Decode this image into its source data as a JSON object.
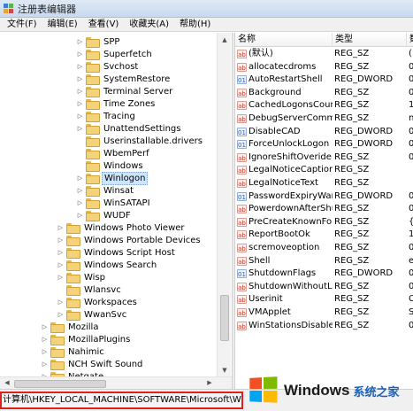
{
  "window": {
    "title": "注册表编辑器"
  },
  "menu": [
    "文件(F)",
    "编辑(E)",
    "查看(V)",
    "收藏夹(A)",
    "帮助(H)"
  ],
  "tree": {
    "items": [
      {
        "label": "SPP",
        "level": 2,
        "expandable": true
      },
      {
        "label": "Superfetch",
        "level": 2,
        "expandable": true
      },
      {
        "label": "Svchost",
        "level": 2,
        "expandable": true
      },
      {
        "label": "SystemRestore",
        "level": 2,
        "expandable": true
      },
      {
        "label": "Terminal Server",
        "level": 2,
        "expandable": true
      },
      {
        "label": "Time Zones",
        "level": 2,
        "expandable": true
      },
      {
        "label": "Tracing",
        "level": 2,
        "expandable": true
      },
      {
        "label": "UnattendSettings",
        "level": 2,
        "expandable": true
      },
      {
        "label": "Userinstallable.drivers",
        "level": 2,
        "expandable": false
      },
      {
        "label": "WbemPerf",
        "level": 2,
        "expandable": false
      },
      {
        "label": "Windows",
        "level": 2,
        "expandable": false
      },
      {
        "label": "Winlogon",
        "level": 2,
        "expandable": true,
        "selected": true
      },
      {
        "label": "Winsat",
        "level": 2,
        "expandable": true
      },
      {
        "label": "WinSATAPI",
        "level": 2,
        "expandable": true
      },
      {
        "label": "WUDF",
        "level": 2,
        "expandable": true
      },
      {
        "label": "Windows Photo Viewer",
        "level": 1,
        "expandable": true
      },
      {
        "label": "Windows Portable Devices",
        "level": 1,
        "expandable": true
      },
      {
        "label": "Windows Script Host",
        "level": 1,
        "expandable": true
      },
      {
        "label": "Windows Search",
        "level": 1,
        "expandable": true
      },
      {
        "label": "Wisp",
        "level": 1,
        "expandable": true
      },
      {
        "label": "Wlansvc",
        "level": 1,
        "expandable": false
      },
      {
        "label": "Workspaces",
        "level": 1,
        "expandable": true
      },
      {
        "label": "WwanSvc",
        "level": 1,
        "expandable": true
      },
      {
        "label": "Mozilla",
        "level": 0,
        "expandable": true
      },
      {
        "label": "MozillaPlugins",
        "level": 0,
        "expandable": true
      },
      {
        "label": "Nahimic",
        "level": 0,
        "expandable": true
      },
      {
        "label": "NCH Swift Sound",
        "level": 0,
        "expandable": true
      },
      {
        "label": "Netgate",
        "level": 0,
        "expandable": true
      }
    ]
  },
  "list": {
    "columns": {
      "name": "名称",
      "type": "类型",
      "data": "数"
    },
    "rows": [
      {
        "name": "(默认)",
        "type": "REG_SZ",
        "data": "(",
        "kind": "sz"
      },
      {
        "name": "allocatecdroms",
        "type": "REG_SZ",
        "data": "0",
        "kind": "sz"
      },
      {
        "name": "AutoRestartShell",
        "type": "REG_DWORD",
        "data": "0",
        "kind": "dw"
      },
      {
        "name": "Background",
        "type": "REG_SZ",
        "data": "0",
        "kind": "sz"
      },
      {
        "name": "CachedLogonsCount",
        "type": "REG_SZ",
        "data": "1",
        "kind": "sz"
      },
      {
        "name": "DebugServerCommand",
        "type": "REG_SZ",
        "data": "n",
        "kind": "sz"
      },
      {
        "name": "DisableCAD",
        "type": "REG_DWORD",
        "data": "0",
        "kind": "dw"
      },
      {
        "name": "ForceUnlockLogon",
        "type": "REG_DWORD",
        "data": "0",
        "kind": "dw"
      },
      {
        "name": "IgnoreShiftOveride",
        "type": "REG_SZ",
        "data": "0",
        "kind": "sz"
      },
      {
        "name": "LegalNoticeCaption",
        "type": "REG_SZ",
        "data": "",
        "kind": "sz"
      },
      {
        "name": "LegalNoticeText",
        "type": "REG_SZ",
        "data": "",
        "kind": "sz"
      },
      {
        "name": "PasswordExpiryWarni...",
        "type": "REG_DWORD",
        "data": "0",
        "kind": "dw"
      },
      {
        "name": "PowerdownAfterShut...",
        "type": "REG_SZ",
        "data": "0",
        "kind": "sz"
      },
      {
        "name": "PreCreateKnownFold...",
        "type": "REG_SZ",
        "data": "{",
        "kind": "sz"
      },
      {
        "name": "ReportBootOk",
        "type": "REG_SZ",
        "data": "1",
        "kind": "sz"
      },
      {
        "name": "scremoveoption",
        "type": "REG_SZ",
        "data": "0",
        "kind": "sz"
      },
      {
        "name": "Shell",
        "type": "REG_SZ",
        "data": "e",
        "kind": "sz"
      },
      {
        "name": "ShutdownFlags",
        "type": "REG_DWORD",
        "data": "0",
        "kind": "dw"
      },
      {
        "name": "ShutdownWithoutLog...",
        "type": "REG_SZ",
        "data": "0",
        "kind": "sz"
      },
      {
        "name": "Userinit",
        "type": "REG_SZ",
        "data": "C",
        "kind": "sz"
      },
      {
        "name": "VMApplet",
        "type": "REG_SZ",
        "data": "S",
        "kind": "sz"
      },
      {
        "name": "WinStationsDisabled",
        "type": "REG_SZ",
        "data": "0",
        "kind": "sz"
      }
    ]
  },
  "statusbar": {
    "path": "计算机\\HKEY_LOCAL_MACHINE\\SOFTWARE\\Microsoft\\Windows NT\\"
  },
  "watermark": {
    "brand": "Windows",
    "site": "系统之家"
  }
}
